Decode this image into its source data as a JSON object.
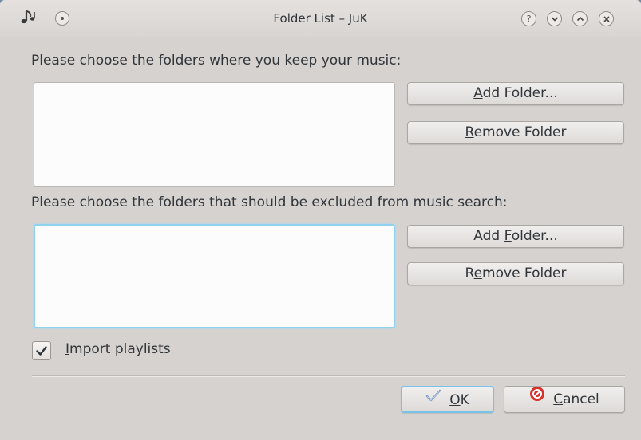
{
  "window": {
    "title": "Folder List – JuK"
  },
  "titlebar_buttons": {
    "help": "?"
  },
  "music_folders": {
    "label": "Please choose the folders where you keep your music:",
    "add_button": {
      "pre": "",
      "mn": "A",
      "post": "dd Folder..."
    },
    "remove_button": {
      "pre": "",
      "mn": "R",
      "post": "emove Folder"
    }
  },
  "excluded_folders": {
    "label": "Please choose the folders that should be excluded from music search:",
    "add_button": {
      "pre": "Add ",
      "mn": "F",
      "post": "older..."
    },
    "remove_button": {
      "pre": "R",
      "mn": "e",
      "post": "move Folder"
    }
  },
  "import_playlists": {
    "checked": true,
    "pre": "",
    "mn": "I",
    "post": "mport playlists"
  },
  "dialog_buttons": {
    "ok": {
      "pre": "",
      "mn": "O",
      "post": "K"
    },
    "cancel": {
      "pre": "",
      "mn": "C",
      "post": "ancel"
    }
  },
  "colors": {
    "focus_border": "#8fd2f0",
    "cancel_icon": "#d9302b",
    "ok_icon": "#7a9cc6"
  },
  "icons": {
    "app": "music-note-icon",
    "ok": "check-icon",
    "cancel": "cancel-icon"
  }
}
